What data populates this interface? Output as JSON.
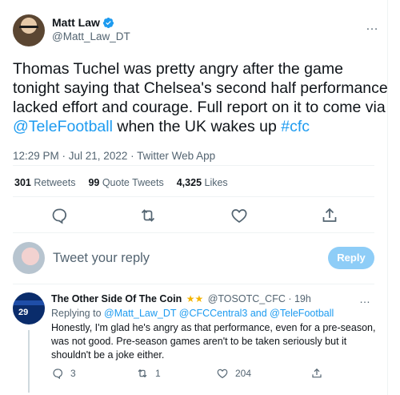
{
  "tweet": {
    "author_name": "Matt Law",
    "author_handle": "@Matt_Law_DT",
    "text_part1": "Thomas Tuchel was pretty angry after the game tonight saying that Chelsea's second half performance lacked effort and courage. Full report on it to come via ",
    "mention": "@TeleFootball",
    "text_part2": "  when the UK wakes up ",
    "hashtag": "#cfc",
    "timestamp": "12:29 PM · Jul 21, 2022 · Twitter Web App",
    "more_icon": "…",
    "stats": {
      "retweets_count": "301",
      "retweets_label": " Retweets",
      "quotes_count": "99",
      "quotes_label": " Quote Tweets",
      "likes_count": "4,325",
      "likes_label": " Likes"
    }
  },
  "reply_box": {
    "placeholder": "Tweet your reply",
    "button_label": "Reply"
  },
  "reply": {
    "name": "The Other Side Of The Coin",
    "stars": "★★",
    "handle_time": "@TOSOTC_CFC · 19h",
    "avatar_number": "29",
    "replying_prefix": "Replying to ",
    "replying_to": "@Matt_Law_DT @CFCCentral3 and @TeleFootball",
    "text": "Honestly, I'm glad he's angry as that performance, even for a pre-season, was not good. Pre-season games aren't to be taken seriously but it shouldn't be a joke either.",
    "more_icon": "…",
    "reply_count": "3",
    "retweet_count": "1",
    "like_count": "204"
  },
  "colors": {
    "accent": "#1d9bf0",
    "reply_button": "#8ecdf7",
    "secondary_text": "#536471"
  },
  "icons": [
    "verified-badge-icon",
    "more-icon",
    "reply-icon",
    "retweet-icon",
    "like-icon",
    "share-icon"
  ]
}
